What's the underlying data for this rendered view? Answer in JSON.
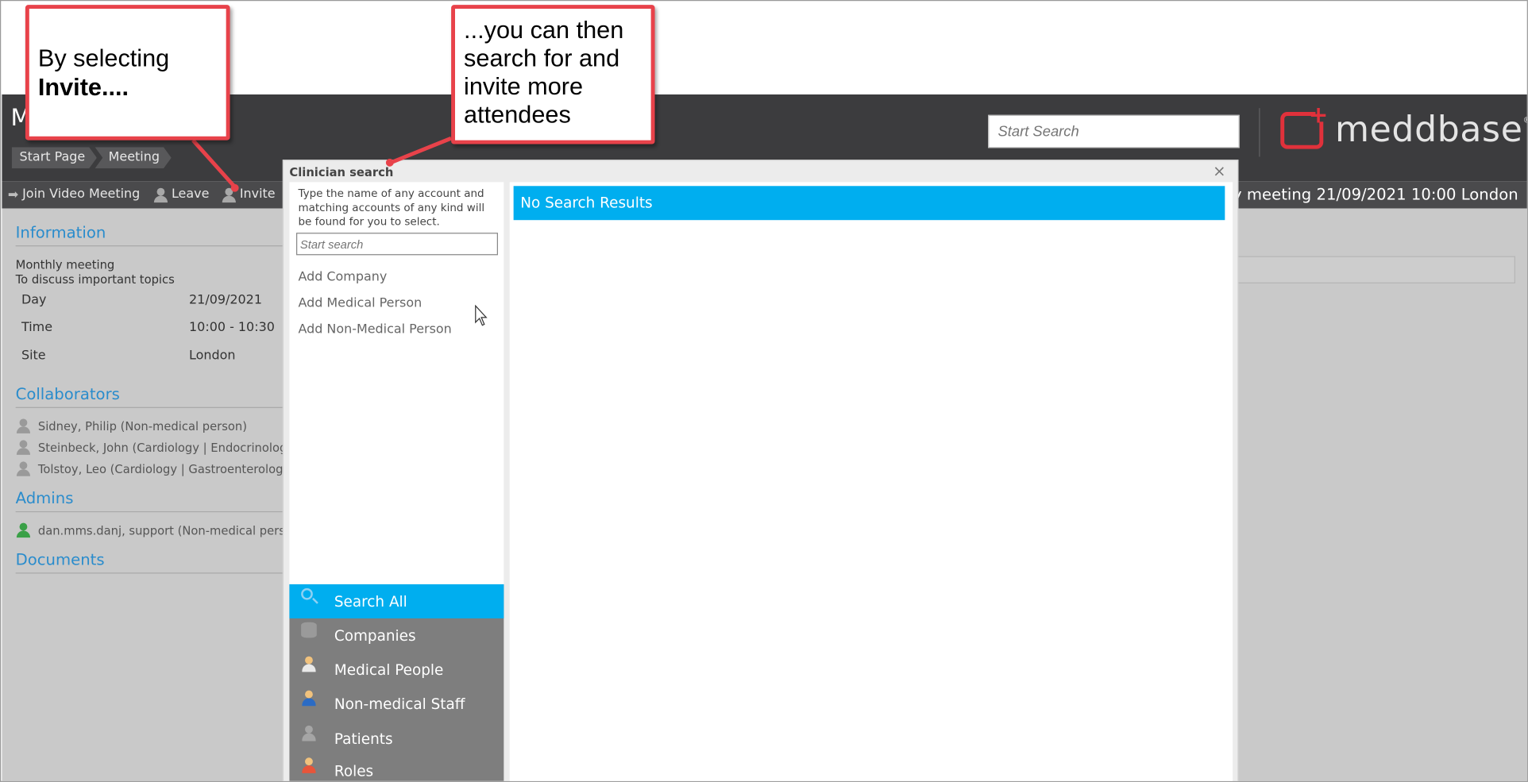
{
  "header": {
    "title_letter": "M",
    "breadcrumb": [
      "Start Page",
      "Meeting"
    ],
    "search_placeholder": "Start Search",
    "logo_text": "meddbase",
    "logo_mark": "®"
  },
  "toolbar": {
    "join": "Join Video Meeting",
    "leave": "Leave",
    "invite": "Invite",
    "meeting_title": "ly meeting 21/09/2021 10:00 London"
  },
  "page": {
    "information_heading": "Information",
    "desc_line1": "Monthly meeting",
    "desc_line2": "To discuss important topics",
    "fields": [
      {
        "label": "Day",
        "value": "21/09/2021"
      },
      {
        "label": "Time",
        "value": "10:00 - 10:30"
      },
      {
        "label": "Site",
        "value": "London"
      }
    ],
    "collaborators_heading": "Collaborators",
    "collaborators": [
      "Sidney, Philip (Non-medical person)",
      "Steinbeck, John (Cardiology | Endocrinology | G",
      "Tolstoy, Leo (Cardiology | Gastroenterology | O"
    ],
    "admins_heading": "Admins",
    "admins": [
      "dan.mms.danj, support (Non-medical person)"
    ],
    "documents_heading": "Documents"
  },
  "dialog": {
    "title": "Clinician search",
    "close": "×",
    "help_text": "Type the name of any account and matching accounts of any kind will be found for you to select.",
    "search_placeholder": "Start search",
    "add_links": [
      "Add Company",
      "Add Medical Person",
      "Add Non-Medical Person"
    ],
    "categories": [
      {
        "label": "Search All",
        "icon": "search-icon",
        "active": true
      },
      {
        "label": "Companies",
        "icon": "database-icon",
        "active": false
      },
      {
        "label": "Medical People",
        "icon": "doctor-icon",
        "active": false
      },
      {
        "label": "Non-medical Staff",
        "icon": "staff-icon",
        "active": false
      },
      {
        "label": "Patients",
        "icon": "patient-icon",
        "active": false
      },
      {
        "label": "Roles",
        "icon": "roles-icon",
        "active": false
      }
    ],
    "results_text": "No Search Results"
  },
  "callouts": {
    "first_line": "By selecting",
    "first_bold": "Invite....",
    "second": "...you can then search for and invite more attendees"
  },
  "colors": {
    "accent": "#00aeef",
    "callout_border": "#e8424a",
    "heading_blue": "#2a8ccc",
    "logo_red": "#e0313b"
  }
}
